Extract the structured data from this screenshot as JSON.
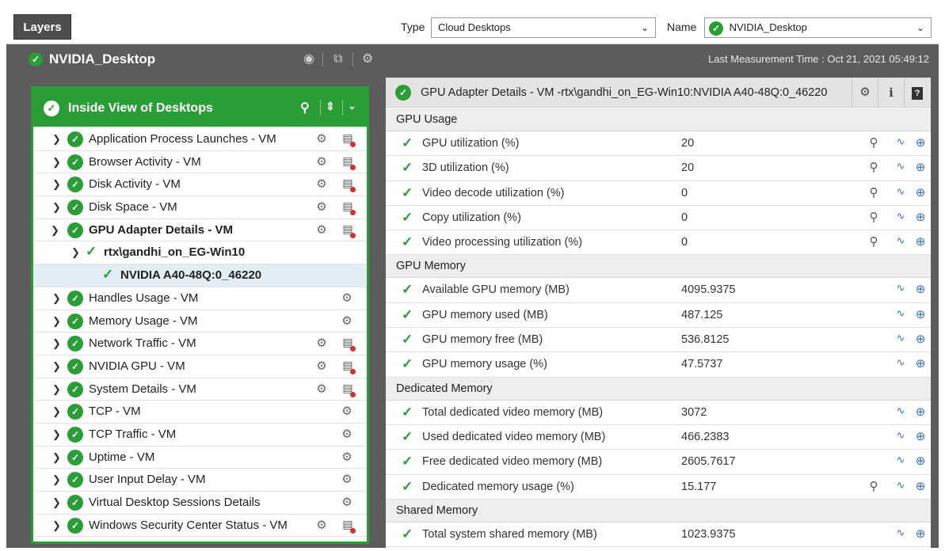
{
  "topbar": {
    "layers_tab": "Layers",
    "type_label": "Type",
    "type_value": "Cloud Desktops",
    "name_label": "Name",
    "name_value": "NVIDIA_Desktop"
  },
  "titlebar": {
    "title": "NVIDIA_Desktop",
    "last_measurement": "Last Measurement Time : Oct 21, 2021 05:49:12"
  },
  "left_panel": {
    "title": "Inside View of Desktops",
    "items": [
      {
        "label": "Application Process Launches - VM"
      },
      {
        "label": "Browser Activity - VM"
      },
      {
        "label": "Disk Activity - VM"
      },
      {
        "label": "Disk Space - VM"
      },
      {
        "label": "GPU Adapter Details - VM"
      },
      {
        "label": "rtx\\gandhi_on_EG-Win10"
      },
      {
        "label": "NVIDIA A40-48Q:0_46220"
      },
      {
        "label": "Handles Usage - VM"
      },
      {
        "label": "Memory Usage - VM"
      },
      {
        "label": "Network Traffic - VM"
      },
      {
        "label": "NVIDIA GPU - VM"
      },
      {
        "label": "System Details - VM"
      },
      {
        "label": "TCP - VM"
      },
      {
        "label": "TCP Traffic - VM"
      },
      {
        "label": "Uptime - VM"
      },
      {
        "label": "User Input Delay - VM"
      },
      {
        "label": "Virtual Desktop Sessions Details"
      },
      {
        "label": "Windows Security Center Status - VM"
      }
    ]
  },
  "right_panel": {
    "title": "GPU Adapter Details - VM -rtx\\gandhi_on_EG-Win10:NVIDIA A40-48Q:0_46220",
    "info_label": "i",
    "help_label": "?",
    "sections": [
      {
        "name": "GPU Usage",
        "rows": [
          {
            "label": "GPU utilization (%)",
            "value": "20"
          },
          {
            "label": "3D utilization (%)",
            "value": "20"
          },
          {
            "label": "Video decode utilization (%)",
            "value": "0"
          },
          {
            "label": "Copy utilization (%)",
            "value": "0"
          },
          {
            "label": "Video processing utilization (%)",
            "value": "0"
          }
        ]
      },
      {
        "name": "GPU Memory",
        "rows": [
          {
            "label": "Available GPU memory (MB)",
            "value": "4095.9375"
          },
          {
            "label": "GPU memory used (MB)",
            "value": "487.125"
          },
          {
            "label": "GPU memory free (MB)",
            "value": "536.8125"
          },
          {
            "label": "GPU memory usage (%)",
            "value": "47.5737"
          }
        ]
      },
      {
        "name": "Dedicated Memory",
        "rows": [
          {
            "label": "Total dedicated video memory (MB)",
            "value": "3072"
          },
          {
            "label": "Used dedicated video memory (MB)",
            "value": "466.2383"
          },
          {
            "label": "Free dedicated video memory (MB)",
            "value": "2605.7617"
          },
          {
            "label": "Dedicated memory usage (%)",
            "value": "15.177"
          }
        ]
      },
      {
        "name": "Shared Memory",
        "rows": [
          {
            "label": "Total system shared memory (MB)",
            "value": "1023.9375"
          }
        ]
      }
    ]
  },
  "colors": {
    "accent_green": "#2a9d36",
    "frame_dark": "#5c5c5c",
    "trend_blue": "#3b6fb6"
  }
}
